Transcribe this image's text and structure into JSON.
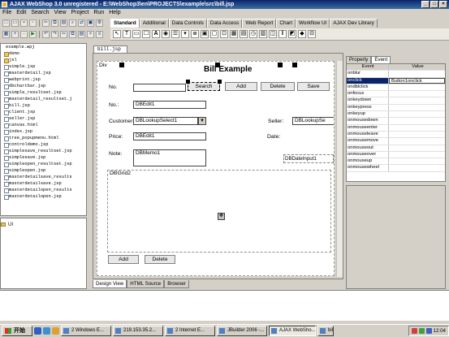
{
  "window": {
    "title": "AJAX WebShop 3.0 unregistered - E:\\WebShop3\\en\\PROJECTS\\example\\src\\bill.jsp"
  },
  "menu": [
    "File",
    "Edit",
    "Search",
    "View",
    "Project",
    "Run",
    "Help"
  ],
  "palette_tabs": [
    "Standard",
    "Additional",
    "Data Controls",
    "Data Access",
    "Web Report",
    "Chart",
    "Workflow UI",
    "AJAX Dev Library"
  ],
  "palette_icons": [
    "arrow-icon",
    "label-icon",
    "button-icon",
    "checkbox-icon",
    "text-icon",
    "radio-icon",
    "listbox-icon",
    "combobox-icon",
    "memo-icon",
    "image-icon",
    "panel-icon",
    "groupbox-icon",
    "grid-icon",
    "frame-icon",
    "timer-icon",
    "scrollbox-icon",
    "iframe-icon",
    "splitter-icon",
    "bevel-icon",
    "shape-icon",
    "tabs-icon"
  ],
  "tree": {
    "root": "example.wpj",
    "items": [
      {
        "label": "demo",
        "type": "dir"
      },
      {
        "label": "jsl",
        "type": "dir"
      },
      {
        "label": "simple.jsp",
        "type": "file"
      },
      {
        "label": "masterdetail.jsp",
        "type": "file"
      },
      {
        "label": "webprint.jsp",
        "type": "file"
      },
      {
        "label": "dbchartbar.jsp",
        "type": "file"
      },
      {
        "label": "simple_resultset.jsp",
        "type": "file"
      },
      {
        "label": "masterdetail_resultset.j",
        "type": "file"
      },
      {
        "label": "bill.jsp",
        "type": "file"
      },
      {
        "label": "client.jsp",
        "type": "file"
      },
      {
        "label": "seller.jsp",
        "type": "file"
      },
      {
        "label": "canvas.html",
        "type": "file"
      },
      {
        "label": "index.jsp",
        "type": "file"
      },
      {
        "label": "tree_popupmenu.html",
        "type": "file"
      },
      {
        "label": "controldemo.jsp",
        "type": "file"
      },
      {
        "label": "simplesave_resultset.jsp",
        "type": "file"
      },
      {
        "label": "simplesave.jsp",
        "type": "file"
      },
      {
        "label": "simpleopen_resultset.jsp",
        "type": "file"
      },
      {
        "label": "simpleopen.jsp",
        "type": "file"
      },
      {
        "label": "masterdetailsave_results",
        "type": "file"
      },
      {
        "label": "masterdetailsave.jsp",
        "type": "file"
      },
      {
        "label": "masterdetailopen_results",
        "type": "file"
      },
      {
        "label": "masterdetailopen.jsp",
        "type": "file"
      }
    ]
  },
  "structure": {
    "label": "UI"
  },
  "editor": {
    "file_tab": "bill.jsp",
    "div_label": "Div",
    "title": "Bill Example",
    "no_label": "No.",
    "no2_label": "No.:",
    "customer_label": "Customer:",
    "seller_label": "Seller:",
    "price_label": "Price:",
    "date_label": "Date:",
    "note_label": "Note:",
    "search_btn": "Search",
    "add_btn": "Add",
    "delete_btn": "Delete",
    "save_btn": "Save",
    "dbedit1": "DBEdit1",
    "dblookupselect": "DBLookupSelect1",
    "dblookupse": "DBLookupSe",
    "dbedit1b": "DBEdit1",
    "dbmemo": "DBMemo1",
    "dbdateinput": "DBDateInput1",
    "dbgrid": "DBGrid2",
    "grid_add_btn": "Add",
    "grid_delete_btn": "Delete"
  },
  "bottom_tabs": [
    "Design View",
    "HTML Source",
    "Browser"
  ],
  "inspector": {
    "tabs": [
      "Property",
      "Event"
    ],
    "headers": [
      "Event",
      "Value"
    ],
    "rows": [
      {
        "event": "onblur",
        "value": ""
      },
      {
        "event": "onclick",
        "value": "Button1onclick"
      },
      {
        "event": "ondblclick",
        "value": ""
      },
      {
        "event": "onfocus",
        "value": ""
      },
      {
        "event": "onkeydown",
        "value": ""
      },
      {
        "event": "onkeypress",
        "value": ""
      },
      {
        "event": "onkeyup",
        "value": ""
      },
      {
        "event": "onmousedown",
        "value": ""
      },
      {
        "event": "onmouseenter",
        "value": ""
      },
      {
        "event": "onmouseleave",
        "value": ""
      },
      {
        "event": "onmousemove",
        "value": ""
      },
      {
        "event": "onmouseout",
        "value": ""
      },
      {
        "event": "onmouseover",
        "value": ""
      },
      {
        "event": "onmouseup",
        "value": ""
      },
      {
        "event": "onmousewheel",
        "value": ""
      }
    ]
  },
  "taskbar": {
    "start": "开始",
    "tasks": [
      "2 Windows E...",
      "219.153.35.2...",
      "2 Internet E...",
      "JBuilder 2006 -...",
      "AJAX WebSho...",
      "bill.jsp - ..."
    ],
    "active_task_index": 4,
    "clock": "12:04"
  },
  "colors": {
    "titlebar": "#0a246a",
    "selection": "#0a246a",
    "accent": "#3a6ea5"
  }
}
